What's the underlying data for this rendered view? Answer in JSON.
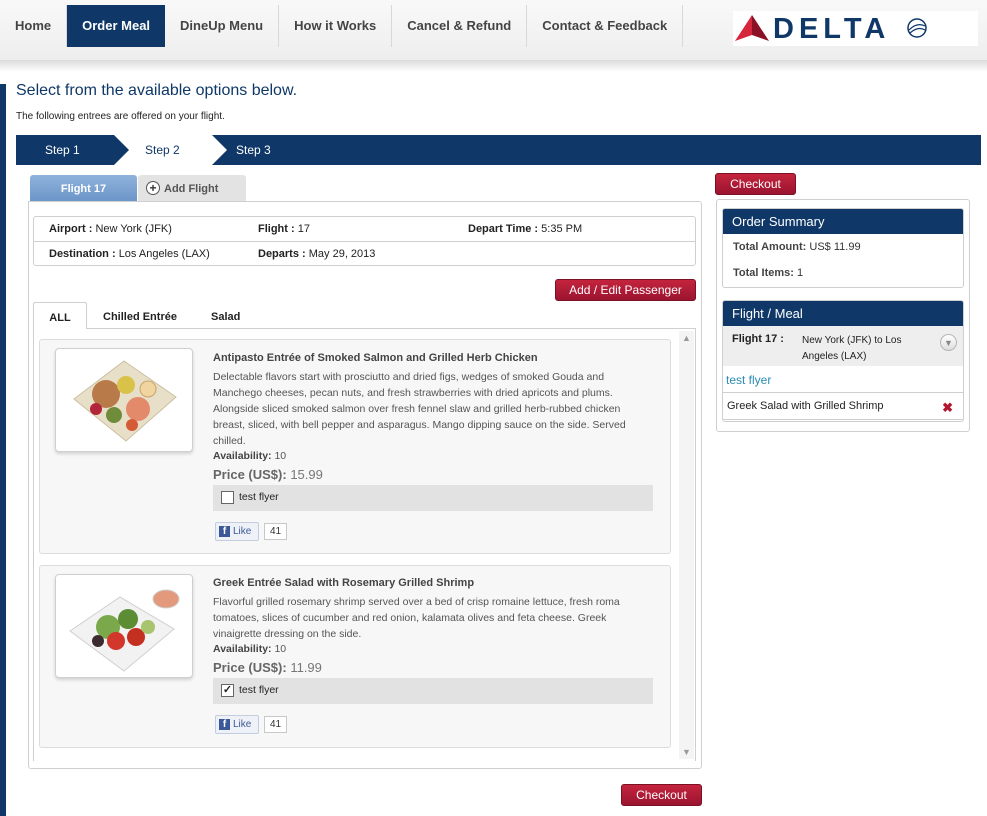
{
  "nav": {
    "items": [
      "Home",
      "Order Meal",
      "DineUp Menu",
      "How it Works",
      "Cancel & Refund",
      "Contact & Feedback"
    ],
    "active": "Order Meal",
    "logo_text": "DELTA"
  },
  "page": {
    "heading": "Select from the available options below.",
    "subheading": "The following entrees are offered on your flight."
  },
  "steps": [
    "Step 1",
    "Step 2",
    "Step 3"
  ],
  "flight_tabs": {
    "active": "Flight 17",
    "add": "Add Flight"
  },
  "flight_info": {
    "airport_label": "Airport :",
    "airport": "New York (JFK)",
    "flight_label": "Flight :",
    "flight": "17",
    "depart_time_label": "Depart Time :",
    "depart_time": "5:35 PM",
    "destination_label": "Destination :",
    "destination": "Los Angeles (LAX)",
    "departs_label": "Departs :",
    "departs": "May 29, 2013"
  },
  "buttons": {
    "add_edit_passenger": "Add / Edit Passenger",
    "checkout": "Checkout"
  },
  "category_tabs": [
    "ALL",
    "Chilled Entrée",
    "Salad"
  ],
  "meals": [
    {
      "title": "Antipasto Entrée of Smoked Salmon and Grilled Herb Chicken",
      "description": "Delectable flavors start with prosciutto and dried figs, wedges of smoked Gouda and Manchego cheeses, pecan nuts, and fresh strawberries with dried apricots and plums. Alongside sliced smoked salmon over fresh fennel slaw and grilled herb-rubbed chicken breast, sliced, with bell pepper and asparagus. Mango dipping sauce on the side. Served chilled.",
      "availability_label": "Availability:",
      "availability": "10",
      "price_label": "Price (US$):",
      "price": "15.99",
      "passenger": "test flyer",
      "checked": false,
      "like_label": "Like",
      "like_count": "41"
    },
    {
      "title": "Greek Entrée Salad with Rosemary Grilled Shrimp",
      "description": "Flavorful grilled rosemary shrimp served over a bed of crisp romaine lettuce, fresh roma tomatoes, slices of cucumber and red onion, kalamata olives and feta cheese. Greek vinaigrette dressing on the side.",
      "availability_label": "Availability:",
      "availability": "10",
      "price_label": "Price (US$):",
      "price": "11.99",
      "passenger": "test flyer",
      "checked": true,
      "like_label": "Like",
      "like_count": "41"
    }
  ],
  "order_summary": {
    "title": "Order Summary",
    "total_amount_label": "Total Amount:",
    "total_amount": "US$ 11.99",
    "total_items_label": "Total Items:",
    "total_items": "1"
  },
  "flight_meal": {
    "title": "Flight / Meal",
    "flight_label": "Flight 17 :",
    "route": "New York (JFK) to Los Angeles (LAX)",
    "passenger": "test flyer",
    "meal": "Greek Salad with Grilled Shrimp"
  },
  "colors": {
    "navy": "#0f3868",
    "red": "#b3152e",
    "link": "#2a8bb7"
  },
  "icons": [
    "delta-widget-icon",
    "plus-circle-icon",
    "scroll-up-icon",
    "scroll-down-icon",
    "facebook-icon",
    "chevron-down-icon",
    "remove-icon",
    "checkbox-icon"
  ]
}
